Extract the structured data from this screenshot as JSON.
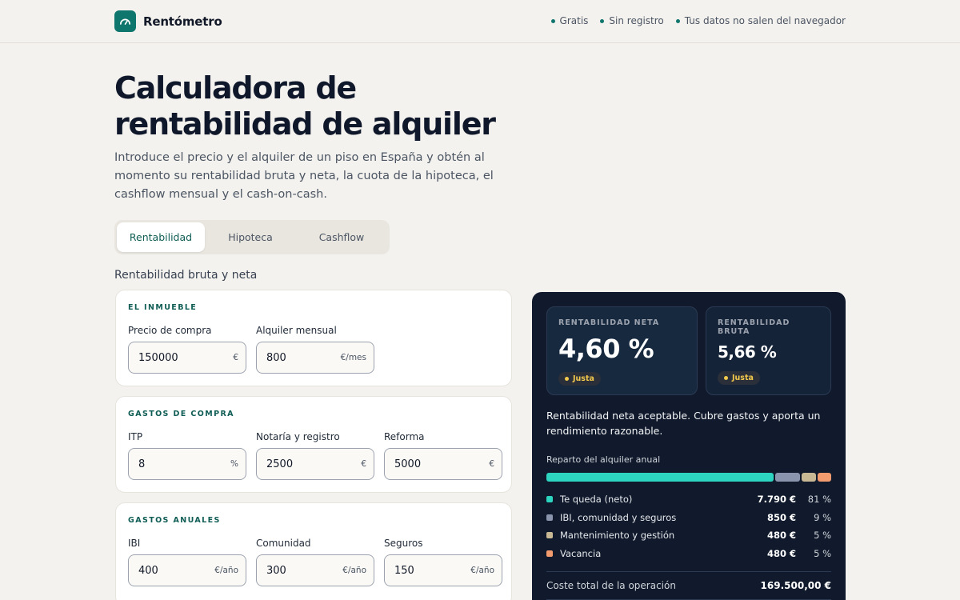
{
  "brand": {
    "name": "Rentómetro",
    "icon": "gauge-icon",
    "color": "#0f766e"
  },
  "header": {
    "features": [
      "Gratis",
      "Sin registro",
      "Tus datos no salen del navegador"
    ]
  },
  "hero": {
    "title_line1": "Calculadora de",
    "title_line2": "rentabilidad de alquiler",
    "description": "Introduce el precio y el alquiler de un piso en España y obtén al momento su rentabilidad bruta y neta, la cuota de la hipoteca, el cashflow mensual y el cash-on-cash."
  },
  "tabs": [
    {
      "label": "Rentabilidad",
      "active": true
    },
    {
      "label": "Hipoteca",
      "active": false
    },
    {
      "label": "Cashflow",
      "active": false
    }
  ],
  "section_title": "Rentabilidad bruta y neta",
  "cards": {
    "inmueble": {
      "label": "EL INMUEBLE",
      "fields": [
        {
          "label": "Precio de compra",
          "value": "150000",
          "unit": "€"
        },
        {
          "label": "Alquiler mensual",
          "value": "800",
          "unit": "€/mes"
        }
      ]
    },
    "compra": {
      "label": "GASTOS DE COMPRA",
      "fields": [
        {
          "label": "ITP",
          "value": "8",
          "unit": "%"
        },
        {
          "label": "Notaría y registro",
          "value": "2500",
          "unit": "€"
        },
        {
          "label": "Reforma",
          "value": "5000",
          "unit": "€"
        }
      ]
    },
    "anuales": {
      "label": "GASTOS ANUALES",
      "fields": [
        {
          "label": "IBI",
          "value": "400",
          "unit": "€/año"
        },
        {
          "label": "Comunidad",
          "value": "300",
          "unit": "€/año"
        },
        {
          "label": "Seguros",
          "value": "150",
          "unit": "€/año"
        }
      ]
    }
  },
  "results": {
    "neta": {
      "label": "RENTABILIDAD NETA",
      "value": "4,60 %",
      "badge": "Justa"
    },
    "bruta": {
      "label": "RENTABILIDAD BRUTA",
      "value": "5,66 %",
      "badge": "Justa"
    },
    "badge_color": "#f2c94c",
    "verdict": "Rentabilidad neta aceptable. Cubre gastos y aporta un rendimiento razonable.",
    "split_title": "Reparto del alquiler anual",
    "split": [
      {
        "name": "Te queda (neto)",
        "amount": "7.790 €",
        "pct": "81 %",
        "share": 81,
        "color": "#2dd4bf"
      },
      {
        "name": "IBI, comunidad y seguros",
        "amount": "850 €",
        "pct": "9 %",
        "share": 9,
        "color": "#8a94ad"
      },
      {
        "name": "Mantenimiento y gestión",
        "amount": "480 €",
        "pct": "5 %",
        "share": 5,
        "color": "#c8b994"
      },
      {
        "name": "Vacancia",
        "amount": "480 €",
        "pct": "5 %",
        "share": 5,
        "color": "#f29b6e"
      }
    ],
    "total_label": "Coste total de la operación",
    "total_value": "169.500,00 €"
  }
}
